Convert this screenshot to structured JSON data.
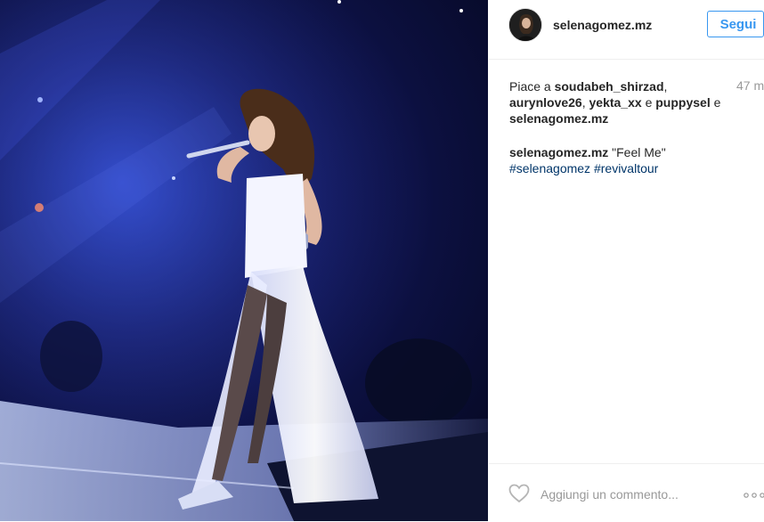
{
  "post": {
    "image_alt": "Performer in white gown singing on stage",
    "colors": {
      "link": "#003569",
      "follow": "#3897f0",
      "muted": "#999999"
    }
  },
  "header": {
    "username": "selenagomez.mz",
    "follow_label": "Segui"
  },
  "likes": {
    "prefix": "Piace a",
    "users": [
      "soudabeh_shirzad",
      "aurynlove26",
      "yekta_xx",
      "puppysel",
      "selenagomez.mz"
    ],
    "sep_comma": ",",
    "sep_and": "e",
    "time_ago": "47 m"
  },
  "caption": {
    "username": "selenagomez.mz",
    "text": "\"Feel Me\"",
    "hashtags": [
      "#selenagomez",
      "#revivaltour"
    ]
  },
  "footer": {
    "comment_placeholder": "Aggiungi un commento...",
    "icons": {
      "like": "heart-icon",
      "more": "more-options-icon"
    }
  }
}
